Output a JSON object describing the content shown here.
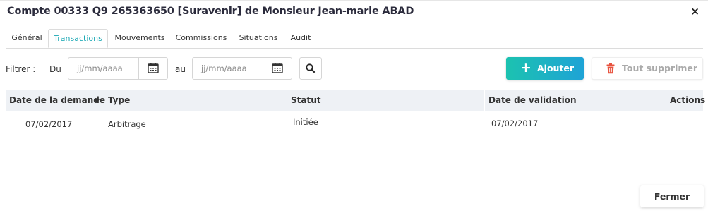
{
  "dialog": {
    "title": "Compte 00333 Q9 265363650 [Suravenir] de Monsieur Jean-marie ABAD",
    "close_label": "×"
  },
  "tabs": [
    {
      "label": "Général",
      "active": false
    },
    {
      "label": "Transactions",
      "active": true
    },
    {
      "label": "Mouvements",
      "active": false
    },
    {
      "label": "Commissions",
      "active": false
    },
    {
      "label": "Situations",
      "active": false
    },
    {
      "label": "Audit",
      "active": false
    }
  ],
  "filter": {
    "label": "Filtrer :",
    "from_label": "Du",
    "from_placeholder": "jj/mm/aaaa",
    "to_label": "au",
    "to_placeholder": "jj/mm/aaaa"
  },
  "actions": {
    "add_label": "Ajouter",
    "delete_all_label": "Tout supprimer"
  },
  "table": {
    "columns": [
      "Date de la demande",
      "Type",
      "Statut",
      "Date de validation",
      "Actions"
    ],
    "sorted_column": "Date de la demande",
    "rows": [
      [
        "07/02/2017",
        "Arbitrage",
        "Initiée",
        "07/02/2017",
        ""
      ]
    ]
  },
  "footer": {
    "close_label": "Fermer"
  },
  "colors": {
    "accent": "#1aa8b4",
    "add_gradient_start": "#1cc2b0",
    "add_gradient_end": "#1ea3d6",
    "delete_icon": "#e8533f",
    "header_bg": "#eef1f5"
  }
}
